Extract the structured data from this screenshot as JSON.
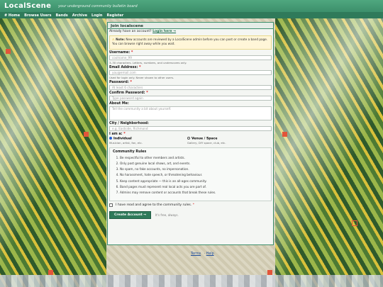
{
  "header": {
    "logo": "LocalScene",
    "tagline": "your underground community bulletin board"
  },
  "nav": {
    "items": [
      "# Home",
      "Browse Users",
      "Bands",
      "Archive",
      "Login",
      "Register"
    ]
  },
  "panel": {
    "title": "Join localscene",
    "have_account": "Already have an account?",
    "login_link": "Login here →",
    "note_label": "Note:",
    "note_text": "New accounts are reviewed by a LocalScene admin before you can post or create a band page. You can browse right away while you wait.",
    "username": {
      "label": "Username:",
      "placeholder": "coolname_99",
      "help": "3–30 characters. Letters, numbers, and underscores only."
    },
    "email": {
      "label": "Email Address:",
      "placeholder": "you@email.com",
      "help": "Used for login only. Never shown to other users."
    },
    "password": {
      "label": "Password:",
      "placeholder": "At least 6 characters"
    },
    "confirm": {
      "label": "Confirm Password:",
      "placeholder": "Type password again"
    },
    "about": {
      "label": "About Me:",
      "placeholder": "Tell the community a bit about yourself."
    },
    "city": {
      "label": "City / Neighborhood:",
      "placeholder": "e.g. Eastside, Richmond"
    },
    "iam": {
      "label": "I am a:",
      "individual": "Individual",
      "individual_sub": "Musician, artist, fan, etc.",
      "venue": "Venue / Space",
      "venue_sub": "Gallery, DIY space, club, etc."
    },
    "rules": {
      "title": "Community Rules",
      "items": [
        "Be respectful to other members and artists.",
        "Only post genuine local shows, art, and events.",
        "No spam, no fake accounts, no impersonation.",
        "No harassment, hate speech, or threatening behaviour.",
        "Keep content appropriate — this is an all-ages community.",
        "Band pages must represent real local acts you are part of.",
        "Admins may remove content or accounts that break these rules."
      ]
    },
    "agree": "I have read and agree to the community rules.",
    "submit": "Create Account →",
    "free": "It's free, always."
  },
  "footer": {
    "terms": "Terms",
    "sep": "·",
    "help": "Help"
  },
  "colors": {
    "accent": "#3c8f6b",
    "nav": "#2f7a5a",
    "required": "#dd2222"
  }
}
